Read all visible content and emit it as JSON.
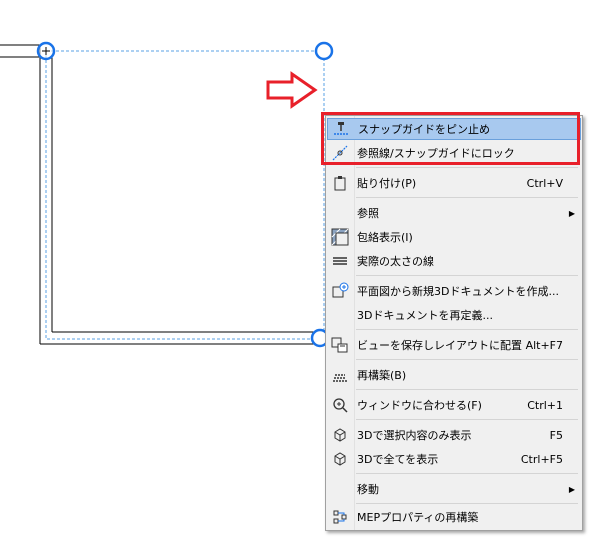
{
  "colors": {
    "accent": "#1a73e8",
    "highlight": "#e8202a",
    "selection": "#a8c9ef"
  },
  "menu": {
    "items": [
      {
        "icon": "snap-pin-icon",
        "label": "スナップガイドをピン止め",
        "shortcut": ""
      },
      {
        "icon": "lock-reference-icon",
        "label": "参照線/スナップガイドにロック",
        "shortcut": ""
      },
      {
        "icon": "paste-icon",
        "label": "貼り付け(P)",
        "shortcut": "Ctrl+V"
      },
      {
        "icon": "",
        "label": "参照",
        "shortcut": ""
      },
      {
        "icon": "hatch-icon",
        "label": "包絡表示(I)",
        "shortcut": ""
      },
      {
        "icon": "line-weight-icon",
        "label": "実際の太さの線",
        "shortcut": ""
      },
      {
        "icon": "new-3d-document-icon",
        "label": "平面図から新規3Dドキュメントを作成...",
        "shortcut": ""
      },
      {
        "icon": "",
        "label": "3Dドキュメントを再定義...",
        "shortcut": ""
      },
      {
        "icon": "save-view-icon",
        "label": "ビューを保存しレイアウトに配置",
        "shortcut": "Alt+F7"
      },
      {
        "icon": "rebuild-icon",
        "label": "再構築(B)",
        "shortcut": ""
      },
      {
        "icon": "fit-window-icon",
        "label": "ウィンドウに合わせる(F)",
        "shortcut": "Ctrl+1"
      },
      {
        "icon": "3d-selection-icon",
        "label": "3Dで選択内容のみ表示",
        "shortcut": "F5"
      },
      {
        "icon": "3d-all-icon",
        "label": "3Dで全てを表示",
        "shortcut": "Ctrl+F5"
      },
      {
        "icon": "",
        "label": "移動",
        "shortcut": ""
      },
      {
        "icon": "mep-rebuild-icon",
        "label": "MEPプロパティの再構築",
        "shortcut": ""
      }
    ]
  }
}
